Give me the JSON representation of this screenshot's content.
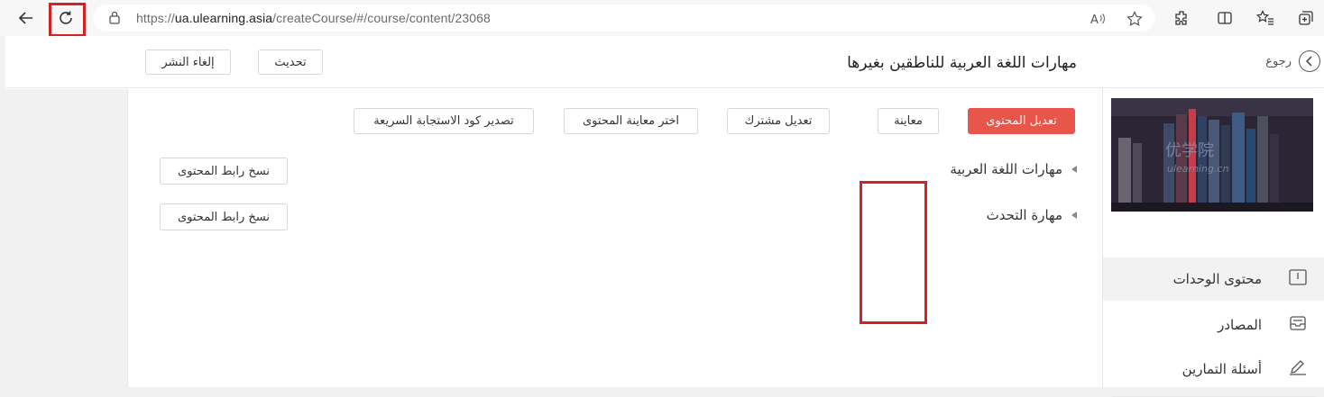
{
  "browser": {
    "url_scheme": "https://",
    "url_host": "ua.ulearning.asia",
    "url_path": "/createCourse/#/course/content/23068"
  },
  "header": {
    "back_label": "رجوع",
    "course_title": "مهارات اللغة العربية للناطقين بغيرها",
    "update_label": "تحديث",
    "unpublish_label": "إلغاء النشر"
  },
  "toolbar": {
    "edit_content": "تعديل المحتوى",
    "preview": "معاينة",
    "shared_edit": "تعديل مشترك",
    "choose_preview": "اختر معاينة المحتوى",
    "export_qr": "تصدير كود الاستجابة السريعة"
  },
  "tree": [
    {
      "title": "مهارات اللغة العربية",
      "copy_label": "نسخ رابط المحتوى"
    },
    {
      "title": "مهارة التحدث",
      "copy_label": "نسخ رابط المحتوى"
    }
  ],
  "sidebar": {
    "thumbnail_watermark": "优学院",
    "thumbnail_sub": "ulearning.cn",
    "items": [
      {
        "label": "محتوى الوحدات",
        "icon": "book-icon"
      },
      {
        "label": "المصادر",
        "icon": "inbox-icon"
      },
      {
        "label": "أسئلة التمارين",
        "icon": "pencil-icon"
      }
    ]
  },
  "colors": {
    "accent": "#e8554b",
    "highlight": "#d42121"
  }
}
